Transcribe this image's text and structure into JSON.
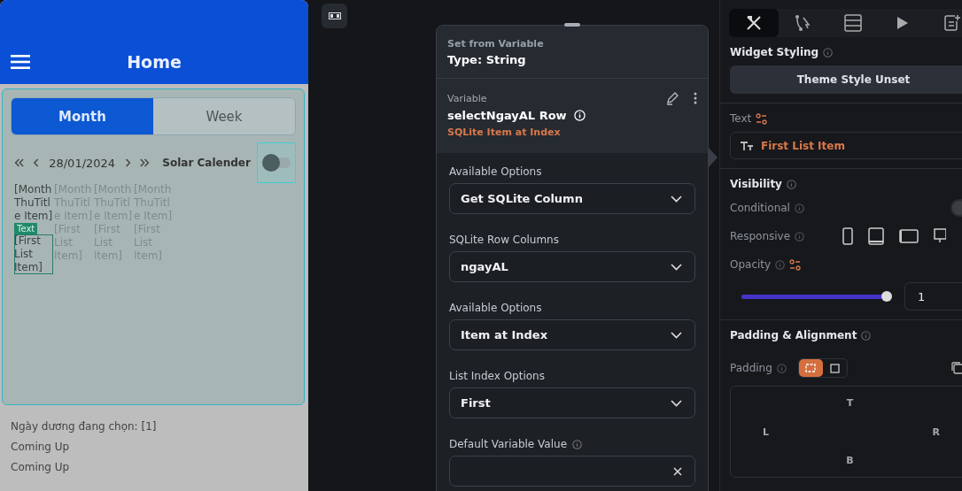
{
  "phone": {
    "title": "Home",
    "tabs": [
      {
        "label": "Month",
        "selected": true
      },
      {
        "label": "Week",
        "selected": false
      }
    ],
    "date": "28/01/2024",
    "solar_label": "Solar Calender",
    "solar_on": false,
    "cells": [
      {
        "header": "[Month ThuTitle Item]",
        "item": "[First List Item]",
        "selected": true
      },
      {
        "header": "[Month ThuTitle Item]",
        "item": "[First List Item]",
        "selected": false
      },
      {
        "header": "[Month ThuTitle Item]",
        "item": "[First List Item]",
        "selected": false
      },
      {
        "header": "[Month ThuTitle Item]",
        "item": "[First List Item]",
        "selected": false
      }
    ],
    "selection_tag": "Text",
    "lines": [
      "Ngày dương đang chọn: [1]",
      "Coming Up",
      "Coming Up"
    ]
  },
  "popup": {
    "subtitle": "Set from Variable",
    "title": "Type: String",
    "variable": {
      "label": "Variable",
      "name": "selectNgayAL Row",
      "source": "SQLite Item at Index"
    },
    "fields": [
      {
        "label": "Available Options",
        "value": "Get SQLite Column",
        "kind": "dropdown"
      },
      {
        "label": "SQLite Row Columns",
        "value": "ngayAL",
        "kind": "dropdown"
      },
      {
        "label": "Available Options",
        "value": "Item at Index",
        "kind": "dropdown"
      },
      {
        "label": "List Index Options",
        "value": "First",
        "kind": "dropdown"
      },
      {
        "label": "Default Variable Value",
        "kind": "text"
      }
    ]
  },
  "panel": {
    "tabs": [
      {
        "selected": true
      },
      {
        "selected": false
      },
      {
        "selected": false
      },
      {
        "selected": false
      },
      {
        "selected": false
      }
    ],
    "styling_title": "Widget Styling",
    "theme_button": "Theme Style Unset",
    "text_label": "Text",
    "text_value": "First List Item",
    "visibility_title": "Visibility",
    "conditional_label": "Conditional",
    "conditional_on": false,
    "responsive_label": "Responsive",
    "opacity_label": "Opacity",
    "opacity": {
      "level": 1,
      "value": "1"
    },
    "padding_title": "Padding & Alignment",
    "padding_label": "Padding",
    "padding_modes": [
      {
        "selected": true
      },
      {
        "selected": false
      }
    ],
    "sides": {
      "top": "T",
      "left": "L",
      "right": "R",
      "bottom": "B"
    }
  }
}
